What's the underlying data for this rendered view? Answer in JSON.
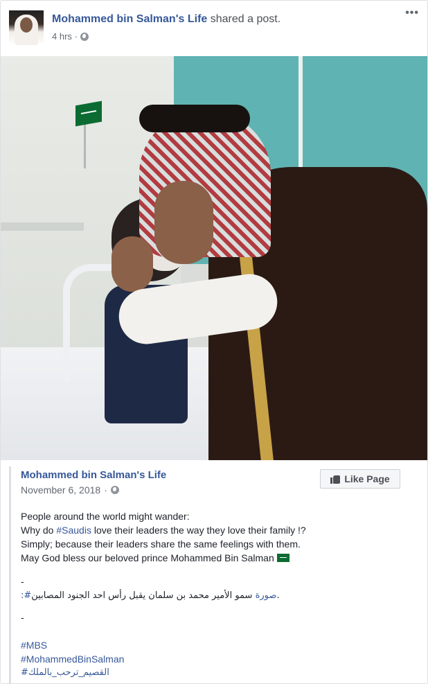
{
  "post": {
    "page_name": "Mohammed bin Salman's Life",
    "action_text": "shared a post.",
    "time": "4 hrs",
    "meta_separator": "·",
    "more_menu": "•••"
  },
  "shared": {
    "page_name": "Mohammed bin Salman's Life",
    "date": "November 6, 2018",
    "meta_separator": "·",
    "like_button_label": "Like Page",
    "body": {
      "line1": "People around the world might wander:",
      "line2_prefix": "Why do ",
      "line2_hashtag": "#Saudis",
      "line2_suffix": " love their leaders the way they love their family !?",
      "line3": "Simply; because their leaders share the same feelings with them.",
      "line4": "May God bless our beloved prince Mohammed Bin Salman"
    },
    "dash1": "-",
    "arabic_line_hashtag": ":#صورة",
    "arabic_line_text": " سمو الأمير محمد بن سلمان يقبل رأس احد الجنود المصابين.",
    "dash2": "-",
    "hashtags": [
      "#MBS",
      "#MohammedBinSalman",
      "#القصيم_ترحب_بالملك"
    ]
  },
  "icons": {
    "globe": "globe-icon",
    "thumb": "thumbs-up-icon",
    "flag": "saudi-flag-emoji"
  },
  "colors": {
    "link_blue": "#365899",
    "meta_gray": "#616770",
    "border": "#dddfe2"
  }
}
